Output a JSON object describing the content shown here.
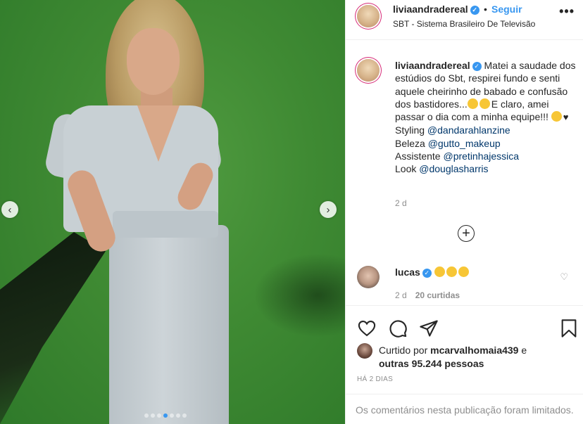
{
  "post": {
    "username": "liviaandradereal",
    "follow_label": "Seguir",
    "separator": "•",
    "location": "SBT - Sistema Brasileiro De Televisão",
    "more_label": "•••"
  },
  "caption": {
    "username": "liviaandradereal",
    "text_1": "Matei a saudade dos estúdios do Sbt, respirei fundo e senti aquele cheirinho de babado e confusão dos bastidores...",
    "text_2": "E claro, amei passar o dia com a minha equipe!!!",
    "styling_label": "Styling",
    "styling_mention": "@dandarahlanzine",
    "beleza_label": "Beleza",
    "beleza_mention": "@gutto_makeup",
    "assistente_label": "Assistente",
    "assistente_mention": "@pretinhajessica",
    "look_label": "Look",
    "look_mention": "@douglasharris",
    "time": "2 d"
  },
  "comment": {
    "username": "lucas",
    "time": "2 d",
    "likes": "20 curtidas"
  },
  "likes": {
    "prefix": "Curtido por",
    "user": "mcarvalhomaia439",
    "conj": "e",
    "others": "outras 95.244 pessoas"
  },
  "ago": "HÁ 2 DIAS",
  "limited_notice": "Os comentários nesta publicação foram limitados.",
  "carousel": {
    "count": 7,
    "active_index": 3
  },
  "colors": {
    "accent": "#3897f0",
    "link": "#00376b",
    "muted": "#8e8e8e",
    "green_screen": "#3f8a33"
  },
  "icons": [
    "chevron-left-icon",
    "chevron-right-icon",
    "verified-icon",
    "more-icon",
    "plus-icon",
    "heart-icon",
    "comment-icon",
    "share-icon",
    "bookmark-icon"
  ]
}
